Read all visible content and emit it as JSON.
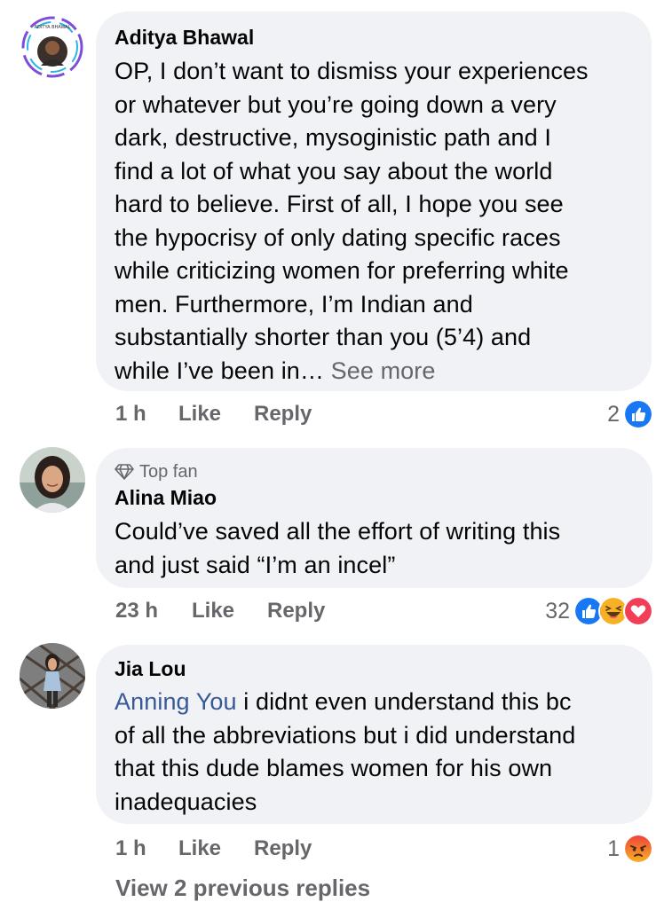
{
  "comments": [
    {
      "author": "Aditya Bhawal",
      "avatar": "avatar-aditya",
      "badge": "",
      "lines": [
        "OP, I don’t want to dismiss your experiences",
        "or whatever but you’re going down a very",
        "dark, destructive, mysoginistic path and I",
        "find a lot of what you say about the world",
        "hard to believe. First of all, I hope you see",
        "the hypocrisy of only dating specific races",
        "while criticizing women for preferring white",
        "men. Furthermore, I’m Indian and",
        "substantially shorter than you (5’4) and",
        "while I’ve been in…"
      ],
      "see_more": "See more",
      "time": "1 h",
      "like": "Like",
      "reply": "Reply",
      "reaction_count": "2",
      "reactions": [
        "like-reaction-icon"
      ]
    },
    {
      "author": "Alina Miao",
      "avatar": "avatar-alina",
      "badge": "Top fan",
      "lines": [
        "Could’ve saved all the effort of writing this",
        "and just said “I’m an incel”"
      ],
      "time": "23 h",
      "like": "Like",
      "reply": "Reply",
      "reaction_count": "32",
      "reactions": [
        "like-reaction-icon",
        "haha-reaction-icon",
        "love-reaction-icon"
      ]
    },
    {
      "author": "Jia Lou",
      "avatar": "avatar-jia",
      "badge": "",
      "mention": "Anning You",
      "first_line_rest": " i didnt even understand this bc",
      "lines": [
        "of all the abbreviations but i did understand",
        "that this dude blames women for his own",
        "inadequacies"
      ],
      "time": "1 h",
      "like": "Like",
      "reply": "Reply",
      "reaction_count": "1",
      "reactions": [
        "angry-reaction-icon"
      ]
    }
  ],
  "footer": {
    "view_previous": "View 2 previous replies"
  },
  "colors": {
    "bubble": "#f0f2f5",
    "meta_text": "#65676b",
    "mention": "#385898",
    "like_blue": "#1877f2",
    "love_red": "#f33e58",
    "haha_yellow": "#f7b125",
    "angry_orange": "#e9710f"
  }
}
